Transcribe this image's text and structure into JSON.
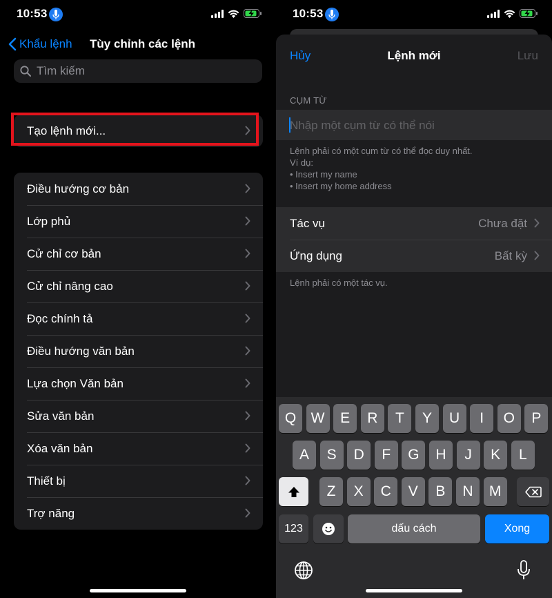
{
  "colors": {
    "accent": "#0a84ff",
    "highlight": "#e3141c",
    "mic_badge": "#1e7cf2",
    "done_key": "#0a84ff"
  },
  "status": {
    "time": "10:53"
  },
  "left": {
    "back_label": "Khẩu lệnh",
    "title": "Tùy chỉnh các lệnh",
    "search_placeholder": "Tìm kiếm",
    "create_label": "Tạo lệnh mới...",
    "items": [
      "Điều hướng cơ bản",
      "Lớp phủ",
      "Cử chỉ cơ bản",
      "Cử chỉ nâng cao",
      "Đọc chính tả",
      "Điều hướng văn bản",
      "Lựa chọn Văn bản",
      "Sửa văn bản",
      "Xóa văn bản",
      "Thiết bị",
      "Trợ năng"
    ]
  },
  "right": {
    "cancel_label": "Hủy",
    "title": "Lệnh mới",
    "save_label": "Lưu",
    "section_header": "CỤM TỪ",
    "phrase_placeholder": "Nhập một cụm từ có thể nói",
    "help_lines": [
      "Lệnh phải có một cụm từ có thể đọc duy nhất.",
      "Ví dụ:",
      "• Insert my name",
      "• Insert my home address"
    ],
    "options": [
      {
        "label": "Tác vụ",
        "value": "Chưa đặt"
      },
      {
        "label": "Ứng dụng",
        "value": "Bất kỳ"
      }
    ],
    "footer_help": "Lệnh phải có một tác vụ."
  },
  "keyboard": {
    "row1": [
      "Q",
      "W",
      "E",
      "R",
      "T",
      "Y",
      "U",
      "I",
      "O",
      "P"
    ],
    "row2": [
      "A",
      "S",
      "D",
      "F",
      "G",
      "H",
      "J",
      "K",
      "L"
    ],
    "row3": [
      "Z",
      "X",
      "C",
      "V",
      "B",
      "N",
      "M"
    ],
    "numbers_label": "123",
    "space_label": "dấu cách",
    "done_label": "Xong"
  }
}
